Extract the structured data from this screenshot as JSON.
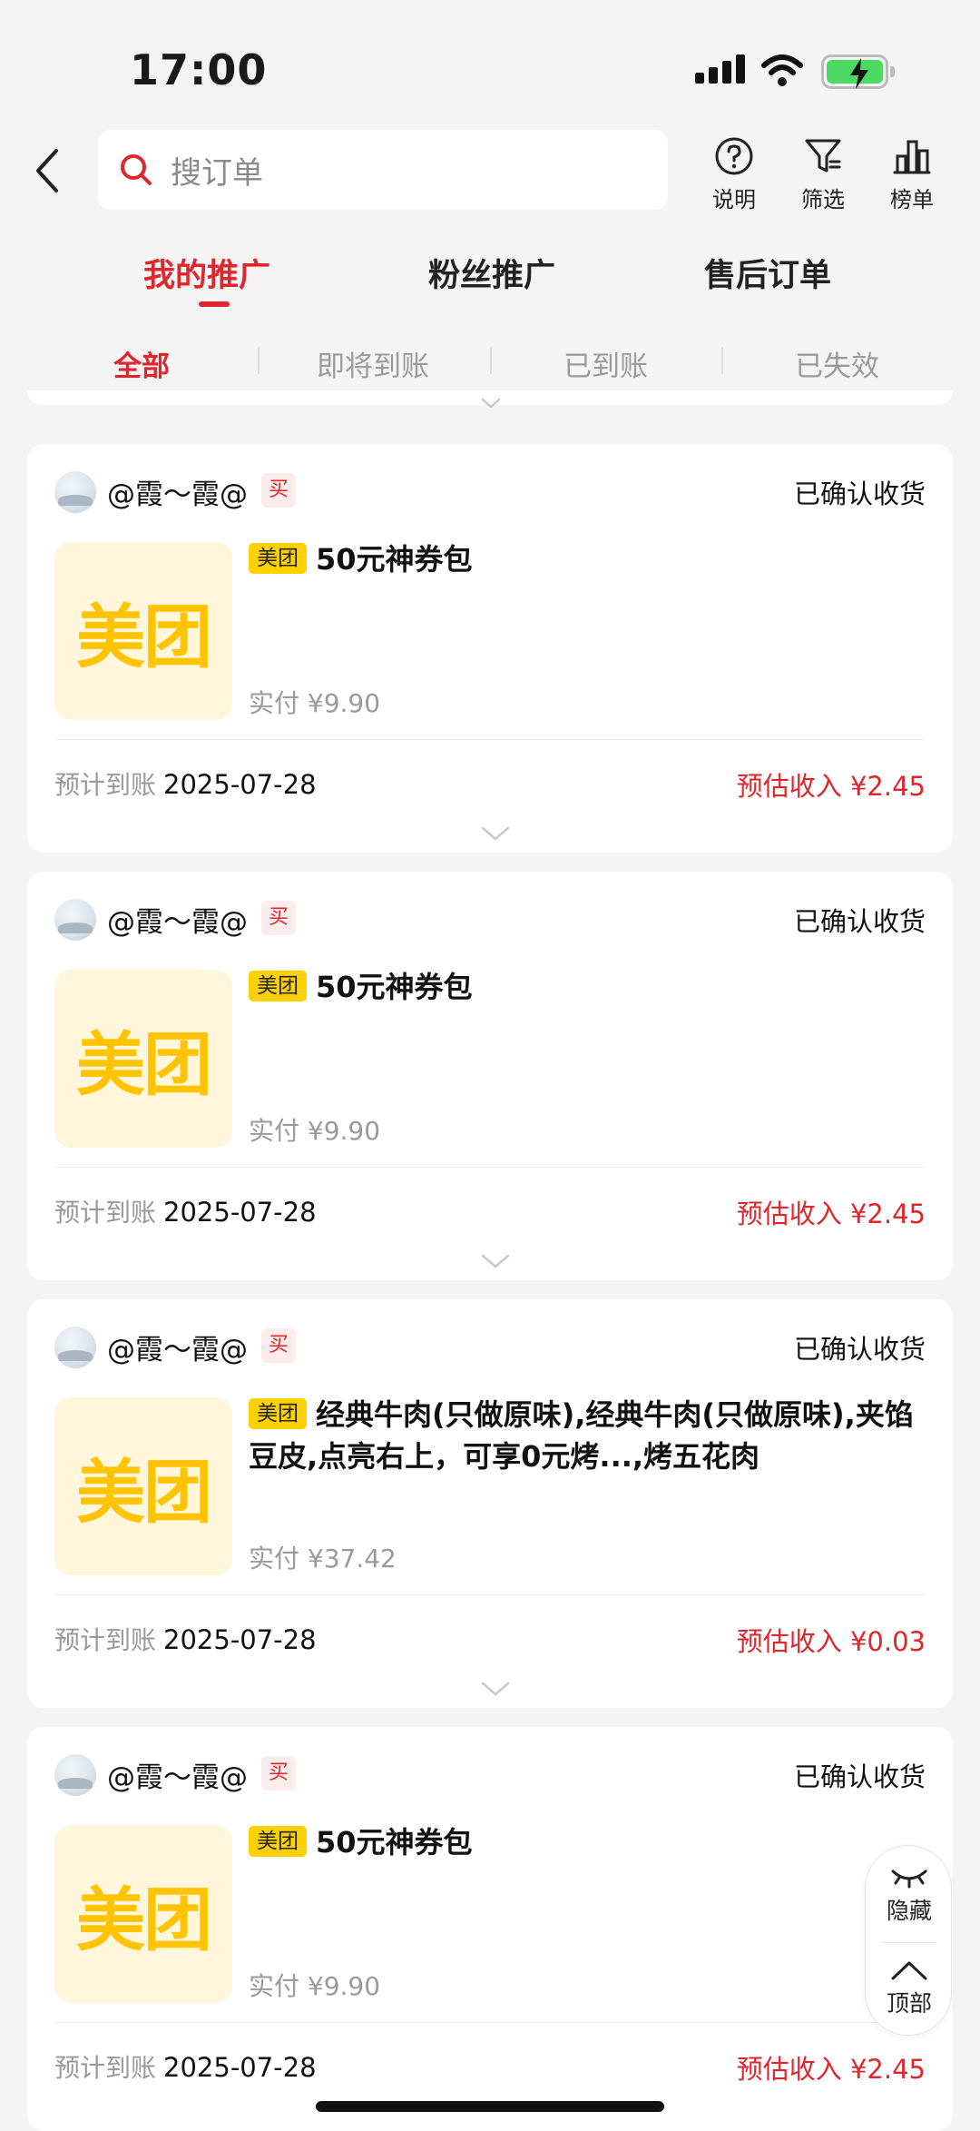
{
  "status_bar": {
    "time": "17:00"
  },
  "search": {
    "placeholder": "搜订单"
  },
  "tools": [
    {
      "label": "说明",
      "icon": "help-circle-icon"
    },
    {
      "label": "筛选",
      "icon": "filter-icon"
    },
    {
      "label": "榜单",
      "icon": "bar-chart-icon"
    }
  ],
  "main_tabs": [
    "我的推广",
    "粉丝推广",
    "售后订单"
  ],
  "sub_tabs": [
    "全部",
    "即将到账",
    "已到账",
    "已失效"
  ],
  "orders": [
    {
      "user": "@霞～霞@",
      "buy_tag": "买",
      "status": "已确认收货",
      "brand": "美团",
      "logo_text": "美团",
      "title": "50元神券包",
      "paid": "实付 ¥9.90",
      "est_label": "预计到账",
      "est_date": "2025-07-28",
      "income": "预估收入 ¥2.45"
    },
    {
      "user": "@霞～霞@",
      "buy_tag": "买",
      "status": "已确认收货",
      "brand": "美团",
      "logo_text": "美团",
      "title": "50元神券包",
      "paid": "实付 ¥9.90",
      "est_label": "预计到账",
      "est_date": "2025-07-28",
      "income": "预估收入 ¥2.45"
    },
    {
      "user": "@霞～霞@",
      "buy_tag": "买",
      "status": "已确认收货",
      "brand": "美团",
      "logo_text": "美团",
      "title": "经典牛肉(只做原味),经典牛肉(只做原味),夹馅豆皮,点亮右上，可享0元烤...,烤五花肉",
      "paid": "实付 ¥37.42",
      "est_label": "预计到账",
      "est_date": "2025-07-28",
      "income": "预估收入 ¥0.03"
    },
    {
      "user": "@霞～霞@",
      "buy_tag": "买",
      "status": "已确认收货",
      "brand": "美团",
      "logo_text": "美团",
      "title": "50元神券包",
      "paid": "实付 ¥9.90",
      "est_label": "预计到账",
      "est_date": "2025-07-28",
      "income": "预估收入 ¥2.45"
    }
  ],
  "float_widget": {
    "hide_label": "隐藏",
    "top_label": "顶部"
  },
  "colors": {
    "accent": "#e0262c",
    "brand_yellow": "#ffd100",
    "background": "#f4f4f4"
  }
}
